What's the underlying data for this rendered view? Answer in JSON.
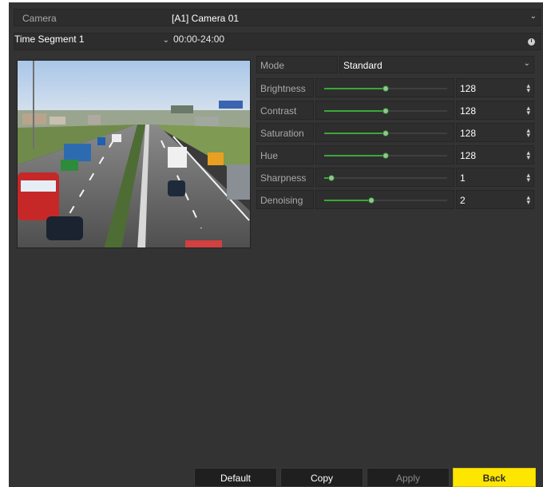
{
  "camera": {
    "label": "Camera",
    "value": "[A1] Camera 01"
  },
  "time_segment": {
    "label": "Time Segment 1",
    "value": "00:00-24:00"
  },
  "mode": {
    "label": "Mode",
    "value": "Standard"
  },
  "params": [
    {
      "label": "Brightness",
      "value": "128",
      "level": 0.5
    },
    {
      "label": "Contrast",
      "value": "128",
      "level": 0.5
    },
    {
      "label": "Saturation",
      "value": "128",
      "level": 0.5
    },
    {
      "label": "Hue",
      "value": "128",
      "level": 0.5
    },
    {
      "label": "Sharpness",
      "value": "1",
      "level": 0.06
    },
    {
      "label": "Denoising",
      "value": "2",
      "level": 0.38
    }
  ],
  "buttons": {
    "default": "Default",
    "copy": "Copy",
    "apply": "Apply",
    "back": "Back"
  },
  "colors": {
    "background": "#333333",
    "slider_fill": "#3aa83a",
    "back_button": "#ffe600"
  },
  "icons": {
    "camera_dropdown": "chevron-down-icon",
    "time_dropdown": "chevron-down-icon",
    "clock": "clock-icon",
    "spinner": "up-down-spinner-icon"
  }
}
